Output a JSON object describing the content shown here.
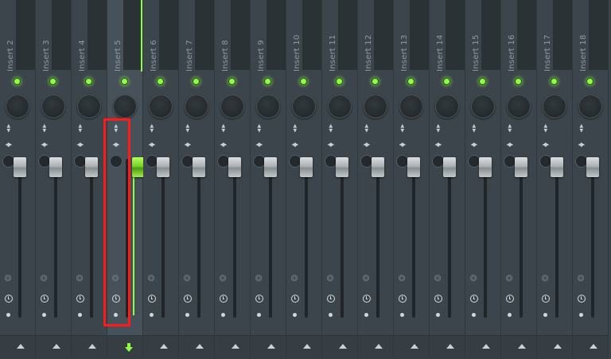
{
  "mixer": {
    "inserts": [
      {
        "label": "Insert 2"
      },
      {
        "label": "Insert 3"
      },
      {
        "label": "Insert 4"
      },
      {
        "label": "Insert 5",
        "selected": true
      },
      {
        "label": "Insert 6"
      },
      {
        "label": "Insert 7"
      },
      {
        "label": "Insert 8"
      },
      {
        "label": "Insert 9"
      },
      {
        "label": "Insert 10"
      },
      {
        "label": "Insert 11"
      },
      {
        "label": "Insert 12"
      },
      {
        "label": "Insert 13"
      },
      {
        "label": "Insert 14"
      },
      {
        "label": "Insert 15"
      },
      {
        "label": "Insert 16"
      },
      {
        "label": "Insert 17"
      },
      {
        "label": "Insert 18"
      }
    ],
    "selected_insert": "Insert 5",
    "icons": {
      "led": "mute-led-icon",
      "knob": "volume-knob-icon",
      "stereo": "stereo-separation-icon",
      "swap": "swap-lr-icon",
      "bulb": "bulb-icon",
      "clock": "latency-clock-icon",
      "send": "route-arrow-icon",
      "send_selected": "route-arrow-down-icon"
    },
    "colors": {
      "accent": "#8cff44",
      "highlight": "#ff1a1a",
      "background": "#3a4349"
    }
  }
}
